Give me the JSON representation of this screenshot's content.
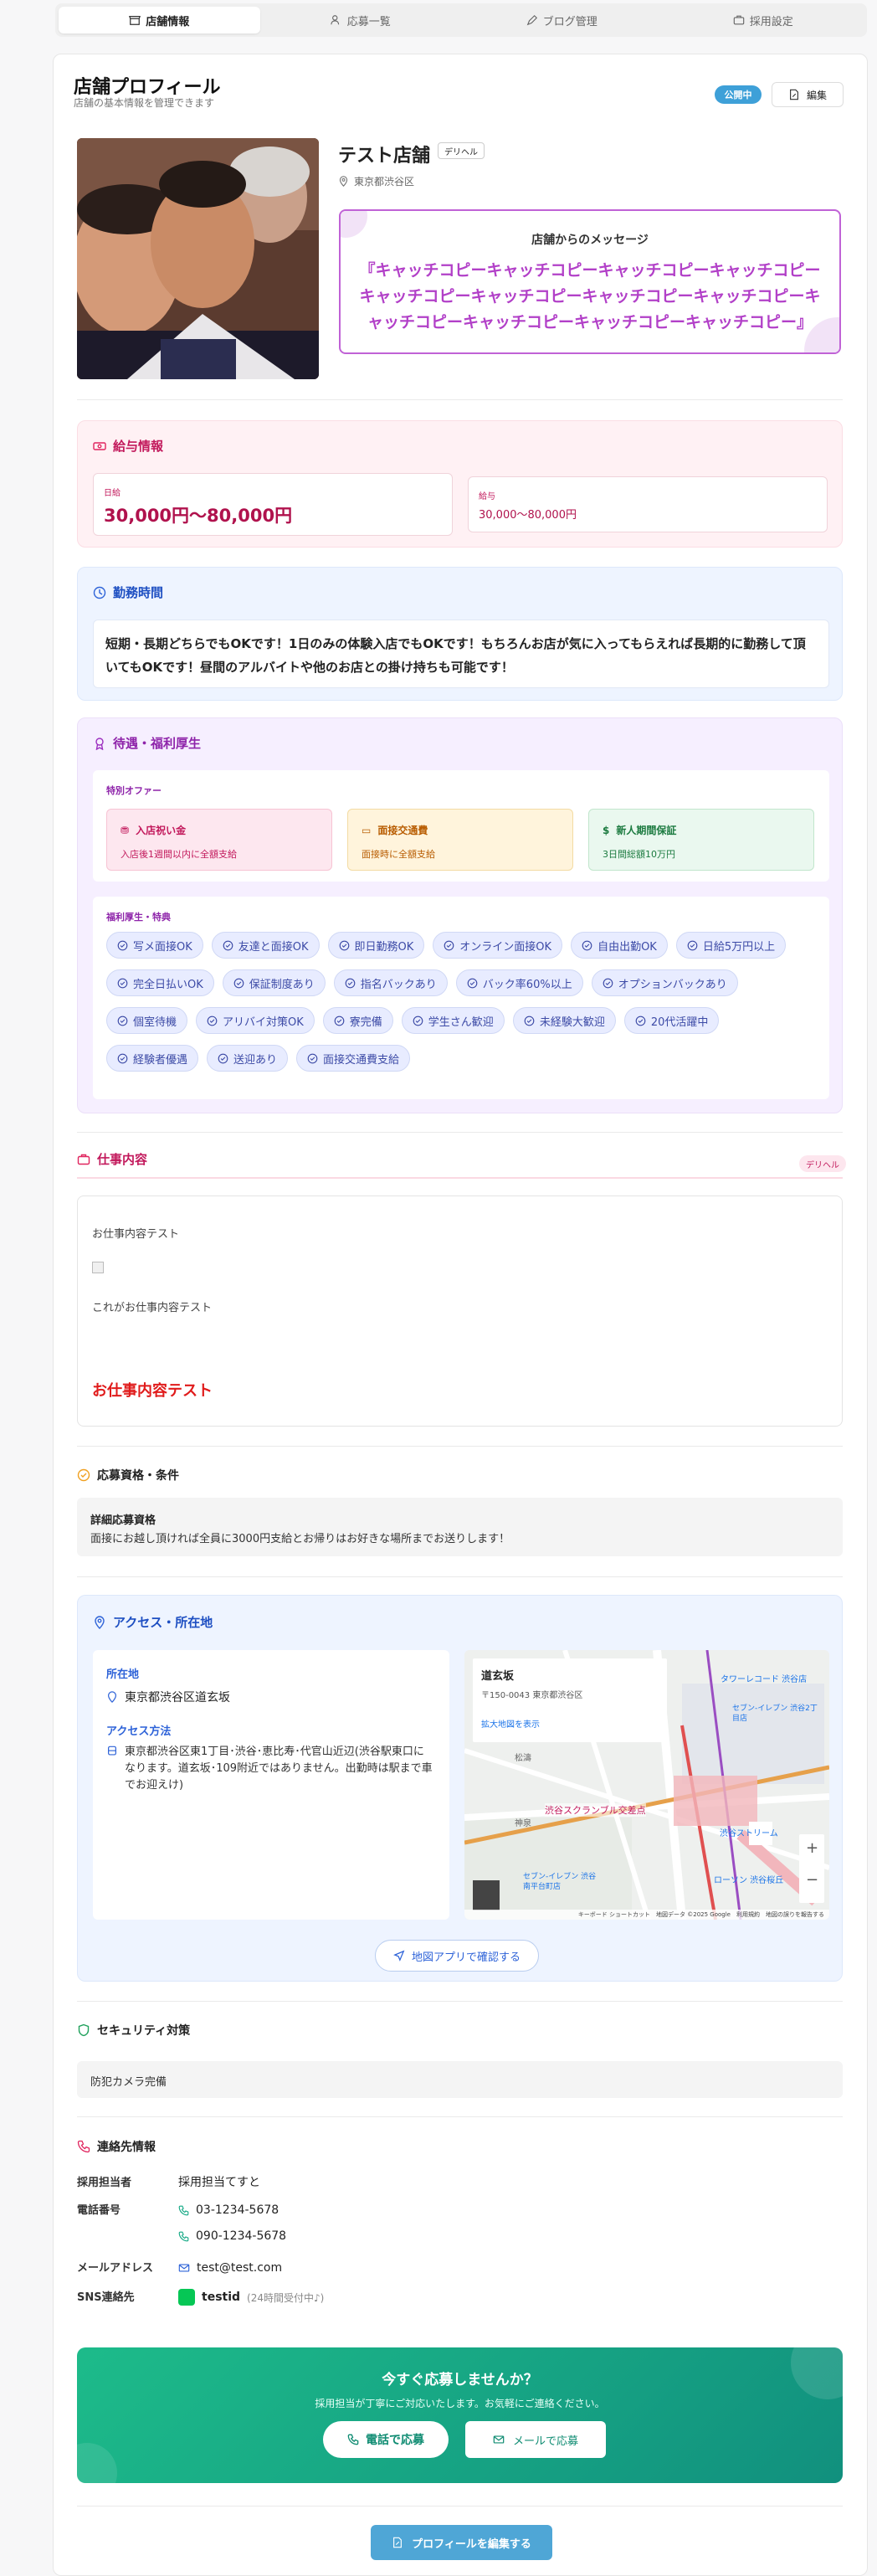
{
  "tabs": [
    {
      "label": "店舗情報",
      "icon": "store-icon"
    },
    {
      "label": "応募一覧",
      "icon": "users-icon"
    },
    {
      "label": "ブログ管理",
      "icon": "pen-icon"
    },
    {
      "label": "採用設定",
      "icon": "briefcase-icon"
    }
  ],
  "header": {
    "title": "店舗プロフィール",
    "subtitle": "店舗の基本情報を管理できます",
    "status": "公開中",
    "edit_label": "編集"
  },
  "shop": {
    "name": "テスト店舗",
    "category": "デリヘル",
    "location": "東京都渋谷区",
    "message_title": "店舗からのメッセージ",
    "message": "『キャッチコピーキャッチコピーキャッチコピーキャッチコピーキャッチコピーキャッチコピーキャッチコピーキャッチコピーキャッチコピーキャッチコピーキャッチコピーキャッチコピー』"
  },
  "salary": {
    "title": "給与情報",
    "daily_label": "日給",
    "daily_value": "30,000円〜80,000円",
    "pay_label": "給与",
    "pay_value": "30,000〜80,000円"
  },
  "hours": {
    "title": "勤務時間",
    "text": "短期・長期どちらでもOKです！1日のみの体験入店でもOKです！もちろんお店が気に入ってもらえれば長期的に勤務して頂いてもOKです！昼間のアルバイトや他のお店との掛け持ちも可能です！"
  },
  "benefits": {
    "title": "待遇・福利厚生",
    "special_title": "特別オファー",
    "offers": [
      {
        "title": "入店祝い金",
        "desc": "入店後1週間以内に全額支給",
        "icon": "gift-icon"
      },
      {
        "title": "面接交通費",
        "desc": "面接時に全額支給",
        "icon": "ticket-icon"
      },
      {
        "title": "新人期間保証",
        "desc": "3日間総額10万円",
        "icon": "dollar-icon"
      }
    ],
    "welfare_title": "福利厚生・特典",
    "chips": [
      "写メ面接OK",
      "友達と面接OK",
      "即日勤務OK",
      "オンライン面接OK",
      "自由出勤OK",
      "日給5万円以上",
      "完全日払いOK",
      "保証制度あり",
      "指名バックあり",
      "バック率60%以上",
      "オプションバックあり",
      "個室待機",
      "アリバイ対策OK",
      "寮完備",
      "学生さん歓迎",
      "未経験大歓迎",
      "20代活躍中",
      "経験者優遇",
      "送迎あり",
      "面接交通費支給"
    ]
  },
  "job": {
    "title": "仕事内容",
    "tag": "デリヘル",
    "line1": "お仕事内容テスト",
    "line2": "これがお仕事内容テスト",
    "highlight": "お仕事内容テスト"
  },
  "requirements": {
    "title": "応募資格・条件",
    "label": "詳細応募資格",
    "text": "面接にお越し頂ければ全員に3000円支給とお帰りはお好きな場所までお送りします！"
  },
  "access": {
    "title": "アクセス・所在地",
    "address_label": "所在地",
    "address": "東京都渋谷区道玄坂",
    "method_label": "アクセス方法",
    "method": "東京都渋谷区東1丁目･渋谷･恵比寿･代官山近辺(渋谷駅東口になります。道玄坂･109附近ではありません。出勤時は駅まで車でお迎えけ)",
    "map": {
      "place": "道玄坂",
      "postal": "〒150-0043 東京都渋谷区",
      "enlarge": "拡大地図を表示",
      "credit": "キーボード ショートカット　地図データ ©2025 Google　利用規約　地図の誤りを報告する",
      "labels": [
        "タワーレコード 渋谷店",
        "渋谷スクランブル交差点",
        "セブン-イレブン 渋谷2丁目店",
        "セブン-イレブン 渋谷南平台町店",
        "ローソン 渋谷桜丘",
        "渋谷ストリーム",
        "松濤",
        "神泉"
      ]
    },
    "map_button": "地図アプリで確認する"
  },
  "security": {
    "title": "セキュリティ対策",
    "text": "防犯カメラ完備"
  },
  "contact": {
    "title": "連絡先情報",
    "person_label": "採用担当者",
    "person": "採用担当てすと",
    "phone_label": "電話番号",
    "phone1": "03-1234-5678",
    "phone2": "090-1234-5678",
    "mail_label": "メールアドレス",
    "mail": "test@test.com",
    "sns_label": "SNS連絡先",
    "sns": "testid",
    "sns_note": "(24時間受付中♪)"
  },
  "cta": {
    "title": "今すぐ応募しませんか？",
    "subtitle": "採用担当が丁寧にご対応いたします。お気軽にご連絡ください。",
    "phone_button": "電話で応募",
    "mail_button": "メールで応募"
  },
  "footer": {
    "edit_profile": "プロフィールを編集する"
  },
  "colors": {
    "accent_blue": "#3ea0d8",
    "pink": "#e0245e",
    "purple": "#b240c8",
    "green": "#15a985"
  }
}
